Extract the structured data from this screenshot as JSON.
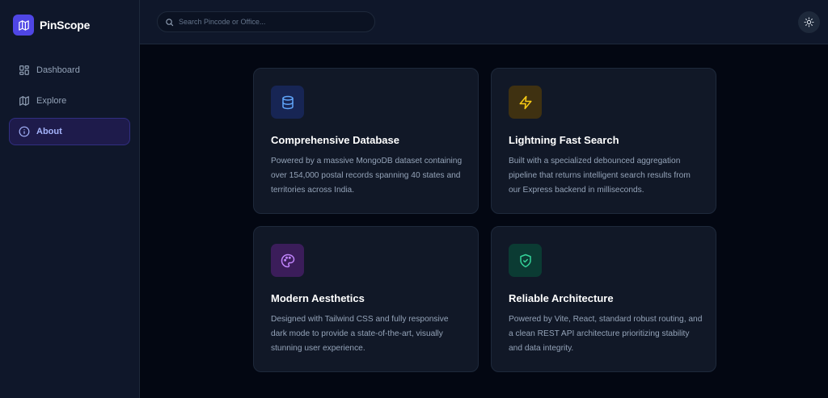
{
  "app": {
    "name": "PinScope"
  },
  "sidebar": {
    "items": [
      {
        "label": "Dashboard",
        "icon": "grid-icon",
        "active": false
      },
      {
        "label": "Explore",
        "icon": "map-icon",
        "active": false
      },
      {
        "label": "About",
        "icon": "info-icon",
        "active": true
      }
    ]
  },
  "header": {
    "search": {
      "placeholder": "Search Pincode or Office...",
      "value": ""
    },
    "theme_icon": "sun-icon"
  },
  "cards": [
    {
      "title": "Comprehensive Database",
      "description": "Powered by a massive MongoDB dataset containing over 154,000 postal records spanning 40 states and territories across India.",
      "icon": "database-icon",
      "icon_color": "#60a5fa",
      "icon_bg": "#172554"
    },
    {
      "title": "Lightning Fast Search",
      "description": "Built with a specialized debounced aggregation pipeline that returns intelligent search results from our Express backend in milliseconds.",
      "icon": "lightning-icon",
      "icon_color": "#facc15",
      "icon_bg": "#3f3111"
    },
    {
      "title": "Modern Aesthetics",
      "description": "Designed with Tailwind CSS and fully responsive dark mode to provide a state-of-the-art, visually stunning user experience.",
      "icon": "palette-icon",
      "icon_color": "#c084fc",
      "icon_bg": "#3b1d5a"
    },
    {
      "title": "Reliable Architecture",
      "description": "Powered by Vite, React, standard robust routing, and a clean REST API architecture prioritizing stability and data integrity.",
      "icon": "shield-check-icon",
      "icon_color": "#34d399",
      "icon_bg": "#0b3b33"
    }
  ],
  "colors": {
    "accent": "#4f46e5",
    "background": "#030712",
    "panel": "#0f172a",
    "card": "#111827"
  }
}
